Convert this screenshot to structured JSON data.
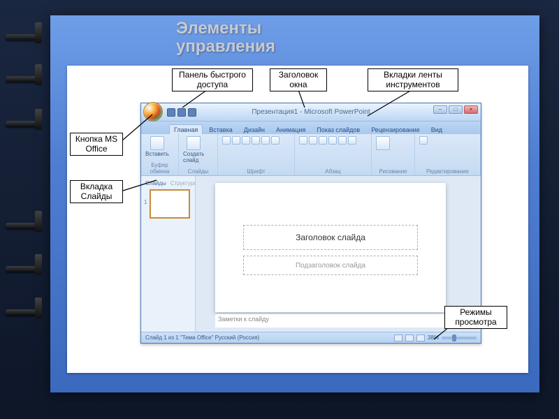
{
  "slide_title_line1": "Элементы",
  "slide_title_line2": "управления",
  "callouts": {
    "qat": "Панель быстрого\nдоступа",
    "windowtitle": "Заголовок\nокна",
    "ribbontabs": "Вкладки ленты\nинструментов",
    "officebtn": "Кнопка\nMS Office",
    "slidestab": "Вкладка\nСлайды",
    "viewmodes": "Режимы\nпросмотра"
  },
  "window": {
    "title": "Презентация1 - Microsoft PowerPoint",
    "controls": {
      "min": "–",
      "max": "□",
      "close": "×"
    }
  },
  "tabs": [
    "Главная",
    "Вставка",
    "Дизайн",
    "Анимация",
    "Показ слайдов",
    "Рецензирование",
    "Вид"
  ],
  "ribbon": {
    "paste": "Вставить",
    "newslide": "Создать\nслайд",
    "group_clipboard": "Буфер обмена",
    "group_slides": "Слайды",
    "group_font": "Шрифт",
    "group_para": "Абзац",
    "group_draw": "Рисование",
    "group_edit": "Редактирование"
  },
  "slidepane": {
    "tab_slides": "Слайды",
    "tab_outline": "Структура",
    "num": "1"
  },
  "canvas": {
    "title_ph": "Заголовок слайда",
    "sub_ph": "Подзаголовок слайда"
  },
  "notes": "Заметки к слайду",
  "status": {
    "left": "Слайд 1 из 1   \"Тема Office\"   Русский (Россия)",
    "zoom": "38%"
  }
}
